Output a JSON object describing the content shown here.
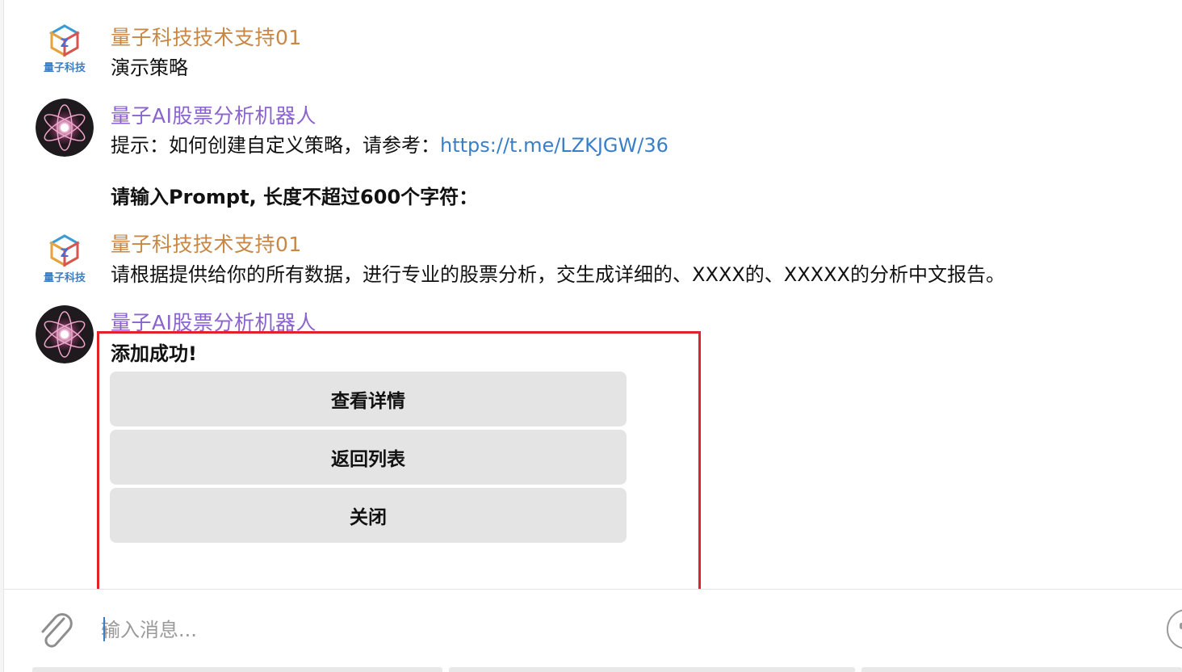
{
  "messages": [
    {
      "sender": "量子科技技术支持01",
      "lines": [
        "演示策略"
      ]
    },
    {
      "sender": "量子AI股票分析机器人",
      "hint_prefix": "提示：如何创建自定义策略，请参考：",
      "hint_link": "https://t.me/LZKJGW/36",
      "prompt_request": "请输入Prompt, 长度不超过600个字符："
    },
    {
      "sender": "量子科技技术支持01",
      "lines": [
        "请根据提供给你的所有数据，进行专业的股票分析，交生成详细的、XXXX的、XXXXX的分析中文报告。"
      ]
    },
    {
      "sender": "量子AI股票分析机器人",
      "success_text": "添加成功!",
      "buttons": [
        "查看详情",
        "返回列表",
        "关闭"
      ]
    }
  ],
  "logo_text": "量子科技",
  "composer": {
    "placeholder": "输入消息..."
  },
  "colors": {
    "support_name": "#c98745",
    "bot_name": "#8b63cc",
    "link": "#3a7fc6",
    "highlight_border": "#e0222a",
    "button_bg": "#e4e4e4"
  },
  "icons": [
    "paperclip-icon",
    "emoji-icon"
  ]
}
